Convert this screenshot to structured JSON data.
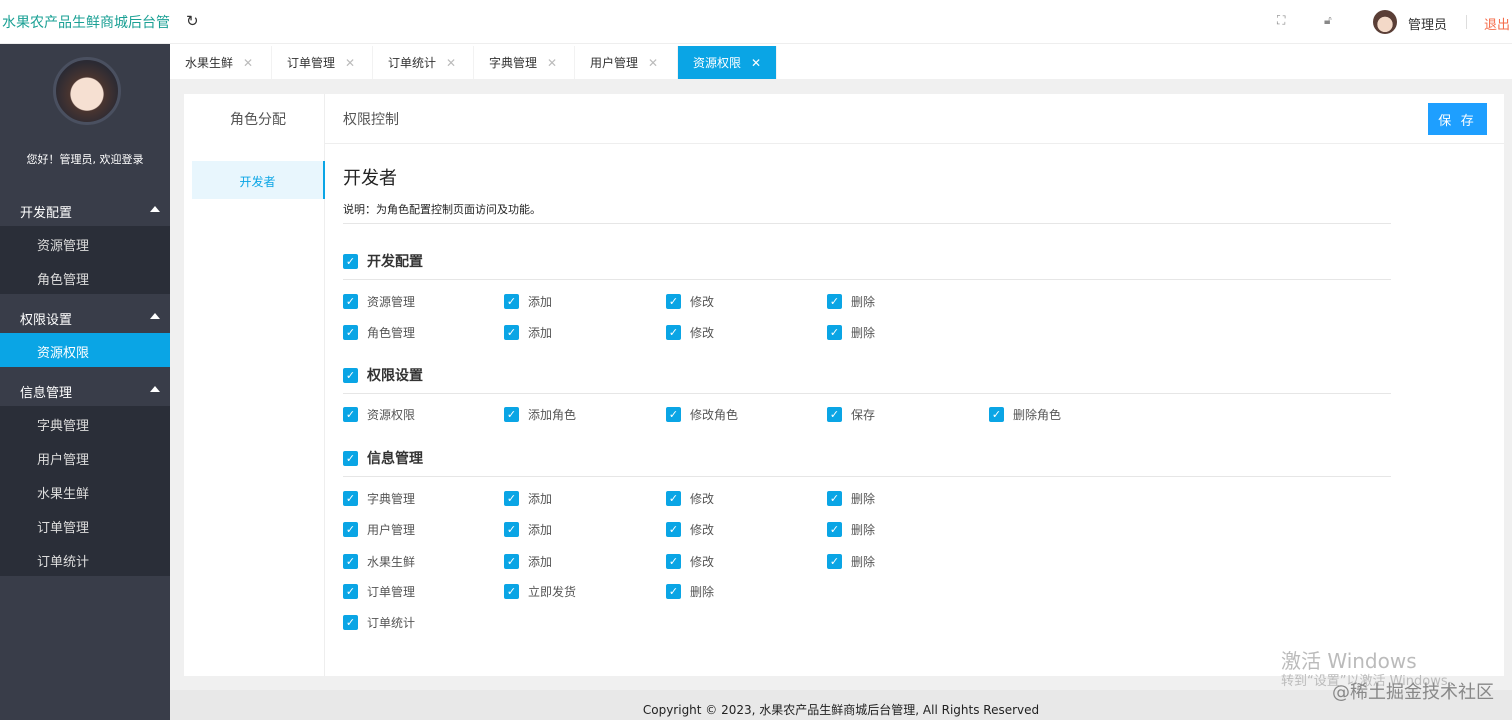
{
  "header": {
    "title": "水果农产品生鲜商城后台管",
    "user": "管理员",
    "logout": "退出"
  },
  "sidebar": {
    "welcome": "您好！管理员, 欢迎登录",
    "groups": [
      {
        "label": "开发配置",
        "items": [
          "资源管理",
          "角色管理"
        ]
      },
      {
        "label": "权限设置",
        "items": [
          "资源权限"
        ]
      },
      {
        "label": "信息管理",
        "items": [
          "字典管理",
          "用户管理",
          "水果生鲜",
          "订单管理",
          "订单统计"
        ]
      }
    ],
    "active": "资源权限"
  },
  "tabs": [
    "水果生鲜",
    "订单管理",
    "订单统计",
    "字典管理",
    "用户管理",
    "资源权限"
  ],
  "active_tab": "资源权限",
  "panel": {
    "left_title": "角色分配",
    "right_title": "权限控制",
    "save": "保 存",
    "roles": [
      "开发者"
    ],
    "role_title": "开发者",
    "description": "说明：为角色配置控制页面访问及功能。"
  },
  "permissions": [
    {
      "group": "开发配置",
      "rows": [
        [
          "资源管理",
          "添加",
          "修改",
          "删除"
        ],
        [
          "角色管理",
          "添加",
          "修改",
          "删除"
        ]
      ]
    },
    {
      "group": "权限设置",
      "rows": [
        [
          "资源权限",
          "添加角色",
          "修改角色",
          "保存",
          "删除角色"
        ]
      ]
    },
    {
      "group": "信息管理",
      "rows": [
        [
          "字典管理",
          "添加",
          "修改",
          "删除"
        ],
        [
          "用户管理",
          "添加",
          "修改",
          "删除"
        ],
        [
          "水果生鲜",
          "添加",
          "修改",
          "删除"
        ],
        [
          "订单管理",
          "立即发货",
          "删除"
        ],
        [
          "订单统计"
        ]
      ]
    }
  ],
  "footer": "Copyright © 2023, 水果农产品生鲜商城后台管理, All Rights Reserved",
  "watermark": {
    "line1": "激活 Windows",
    "line2": "转到“设置”以激活 Windows。",
    "site": "@稀土掘金技术社区"
  },
  "colors": {
    "accent": "#0aa5e5",
    "sidebar": "#393d49",
    "logo": "#1aa094",
    "logout": "#f56c4a"
  }
}
